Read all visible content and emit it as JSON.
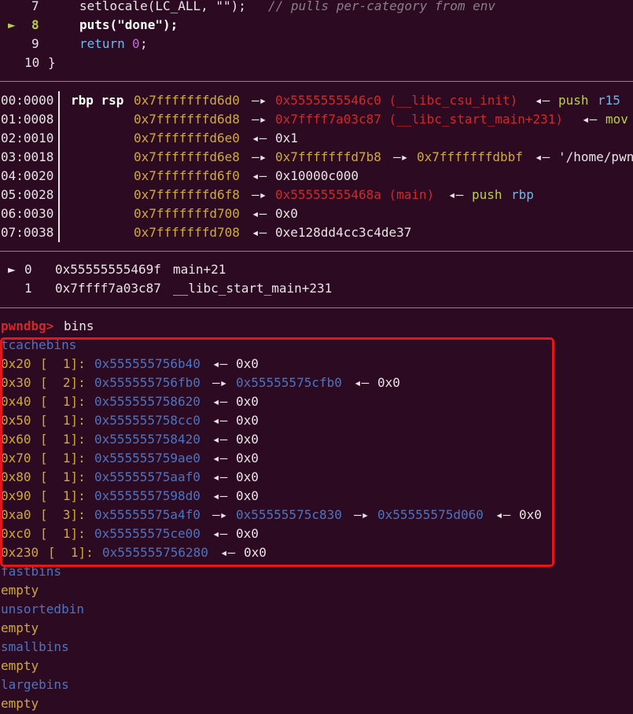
{
  "source": {
    "lines": [
      {
        "num": "7",
        "code": "setlocale(LC_ALL, \"\");",
        "comment": "// pulls per-category from env"
      },
      {
        "num": "8",
        "marker": "►",
        "code": "puts(\"done\");"
      },
      {
        "num": "9",
        "kw": "return",
        "val": "0",
        "end": ";"
      },
      {
        "num": "10",
        "code": "}"
      }
    ]
  },
  "stack": {
    "regs_label": "rbp rsp",
    "rows": [
      {
        "off": "00:0000",
        "addr": "0x7fffffffd6d0",
        "a1": "—▸",
        "v1": "0x5555555546c0 (__libc_csu_init)",
        "a2": "◂—",
        "v2": "push",
        "v3": "r15"
      },
      {
        "off": "01:0008",
        "addr": "0x7fffffffd6d8",
        "a1": "—▸",
        "v1": "0x7ffff7a03c87 (__libc_start_main+231)",
        "a2": "◂—",
        "v2": "mov",
        "v3": ""
      },
      {
        "off": "02:0010",
        "addr": "0x7fffffffd6e0",
        "a1": "◂—",
        "v1": "0x1"
      },
      {
        "off": "03:0018",
        "addr": "0x7fffffffd6e8",
        "a1": "—▸",
        "v1": "0x7fffffffd7b8",
        "a2": "—▸",
        "v2": "0x7fffffffdbbf",
        "a3": "◂—",
        "v3": "'/home/pwn"
      },
      {
        "off": "04:0020",
        "addr": "0x7fffffffd6f0",
        "a1": "◂—",
        "v1": "0x10000c000"
      },
      {
        "off": "05:0028",
        "addr": "0x7fffffffd6f8",
        "a1": "—▸",
        "v1": "0x55555555468a (main)",
        "a2": "◂—",
        "v2": "push",
        "v3": "rbp"
      },
      {
        "off": "06:0030",
        "addr": "0x7fffffffd700",
        "a1": "◂—",
        "v1": "0x0"
      },
      {
        "off": "07:0038",
        "addr": "0x7fffffffd708",
        "a1": "◂—",
        "v1": "0xe128dd4cc3c4de37"
      }
    ]
  },
  "backtrace": [
    {
      "marker": "►",
      "idx": "0",
      "addr": "0x55555555469f",
      "sym": "main+21"
    },
    {
      "marker": "",
      "idx": "1",
      "addr": "0x7ffff7a03c87",
      "sym": "__libc_start_main+231"
    }
  ],
  "prompt": {
    "label": "pwndbg>",
    "command": "bins"
  },
  "tcache": {
    "title": "tcachebins",
    "rows": [
      {
        "size": "0x20",
        "count": "[  1]:",
        "chain": [
          "0x555555756b40"
        ],
        "end": "0x0"
      },
      {
        "size": "0x30",
        "count": "[  2]:",
        "chain": [
          "0x555555756fb0",
          "0x55555575cfb0"
        ],
        "end": "0x0"
      },
      {
        "size": "0x40",
        "count": "[  1]:",
        "chain": [
          "0x555555758620"
        ],
        "end": "0x0"
      },
      {
        "size": "0x50",
        "count": "[  1]:",
        "chain": [
          "0x555555758cc0"
        ],
        "end": "0x0"
      },
      {
        "size": "0x60",
        "count": "[  1]:",
        "chain": [
          "0x555555758420"
        ],
        "end": "0x0"
      },
      {
        "size": "0x70",
        "count": "[  1]:",
        "chain": [
          "0x555555759ae0"
        ],
        "end": "0x0"
      },
      {
        "size": "0x80",
        "count": "[  1]:",
        "chain": [
          "0x55555575aaf0"
        ],
        "end": "0x0"
      },
      {
        "size": "0x90",
        "count": "[  1]:",
        "chain": [
          "0x5555557598d0"
        ],
        "end": "0x0"
      },
      {
        "size": "0xa0",
        "count": "[  3]:",
        "chain": [
          "0x55555575a4f0",
          "0x55555575c830",
          "0x55555575d060"
        ],
        "end": "0x0"
      },
      {
        "size": "0xc0",
        "count": "[  1]:",
        "chain": [
          "0x55555575ce00"
        ],
        "end": "0x0"
      },
      {
        "size": "0x230",
        "count": "[  1]:",
        "chain": [
          "0x555555756280"
        ],
        "end": "0x0"
      }
    ]
  },
  "other_bins": [
    {
      "title": "fastbins",
      "value": "empty"
    },
    {
      "title": "unsortedbin",
      "value": "empty"
    },
    {
      "title": "smallbins",
      "value": "empty"
    },
    {
      "title": "largebins",
      "value": "empty"
    }
  ],
  "arrows": {
    "fwd": "—▸",
    "back": "◂—"
  },
  "colors": {
    "background": "#2c0b22",
    "highlight": "#e3161a",
    "separator": "#6d8bb8"
  }
}
